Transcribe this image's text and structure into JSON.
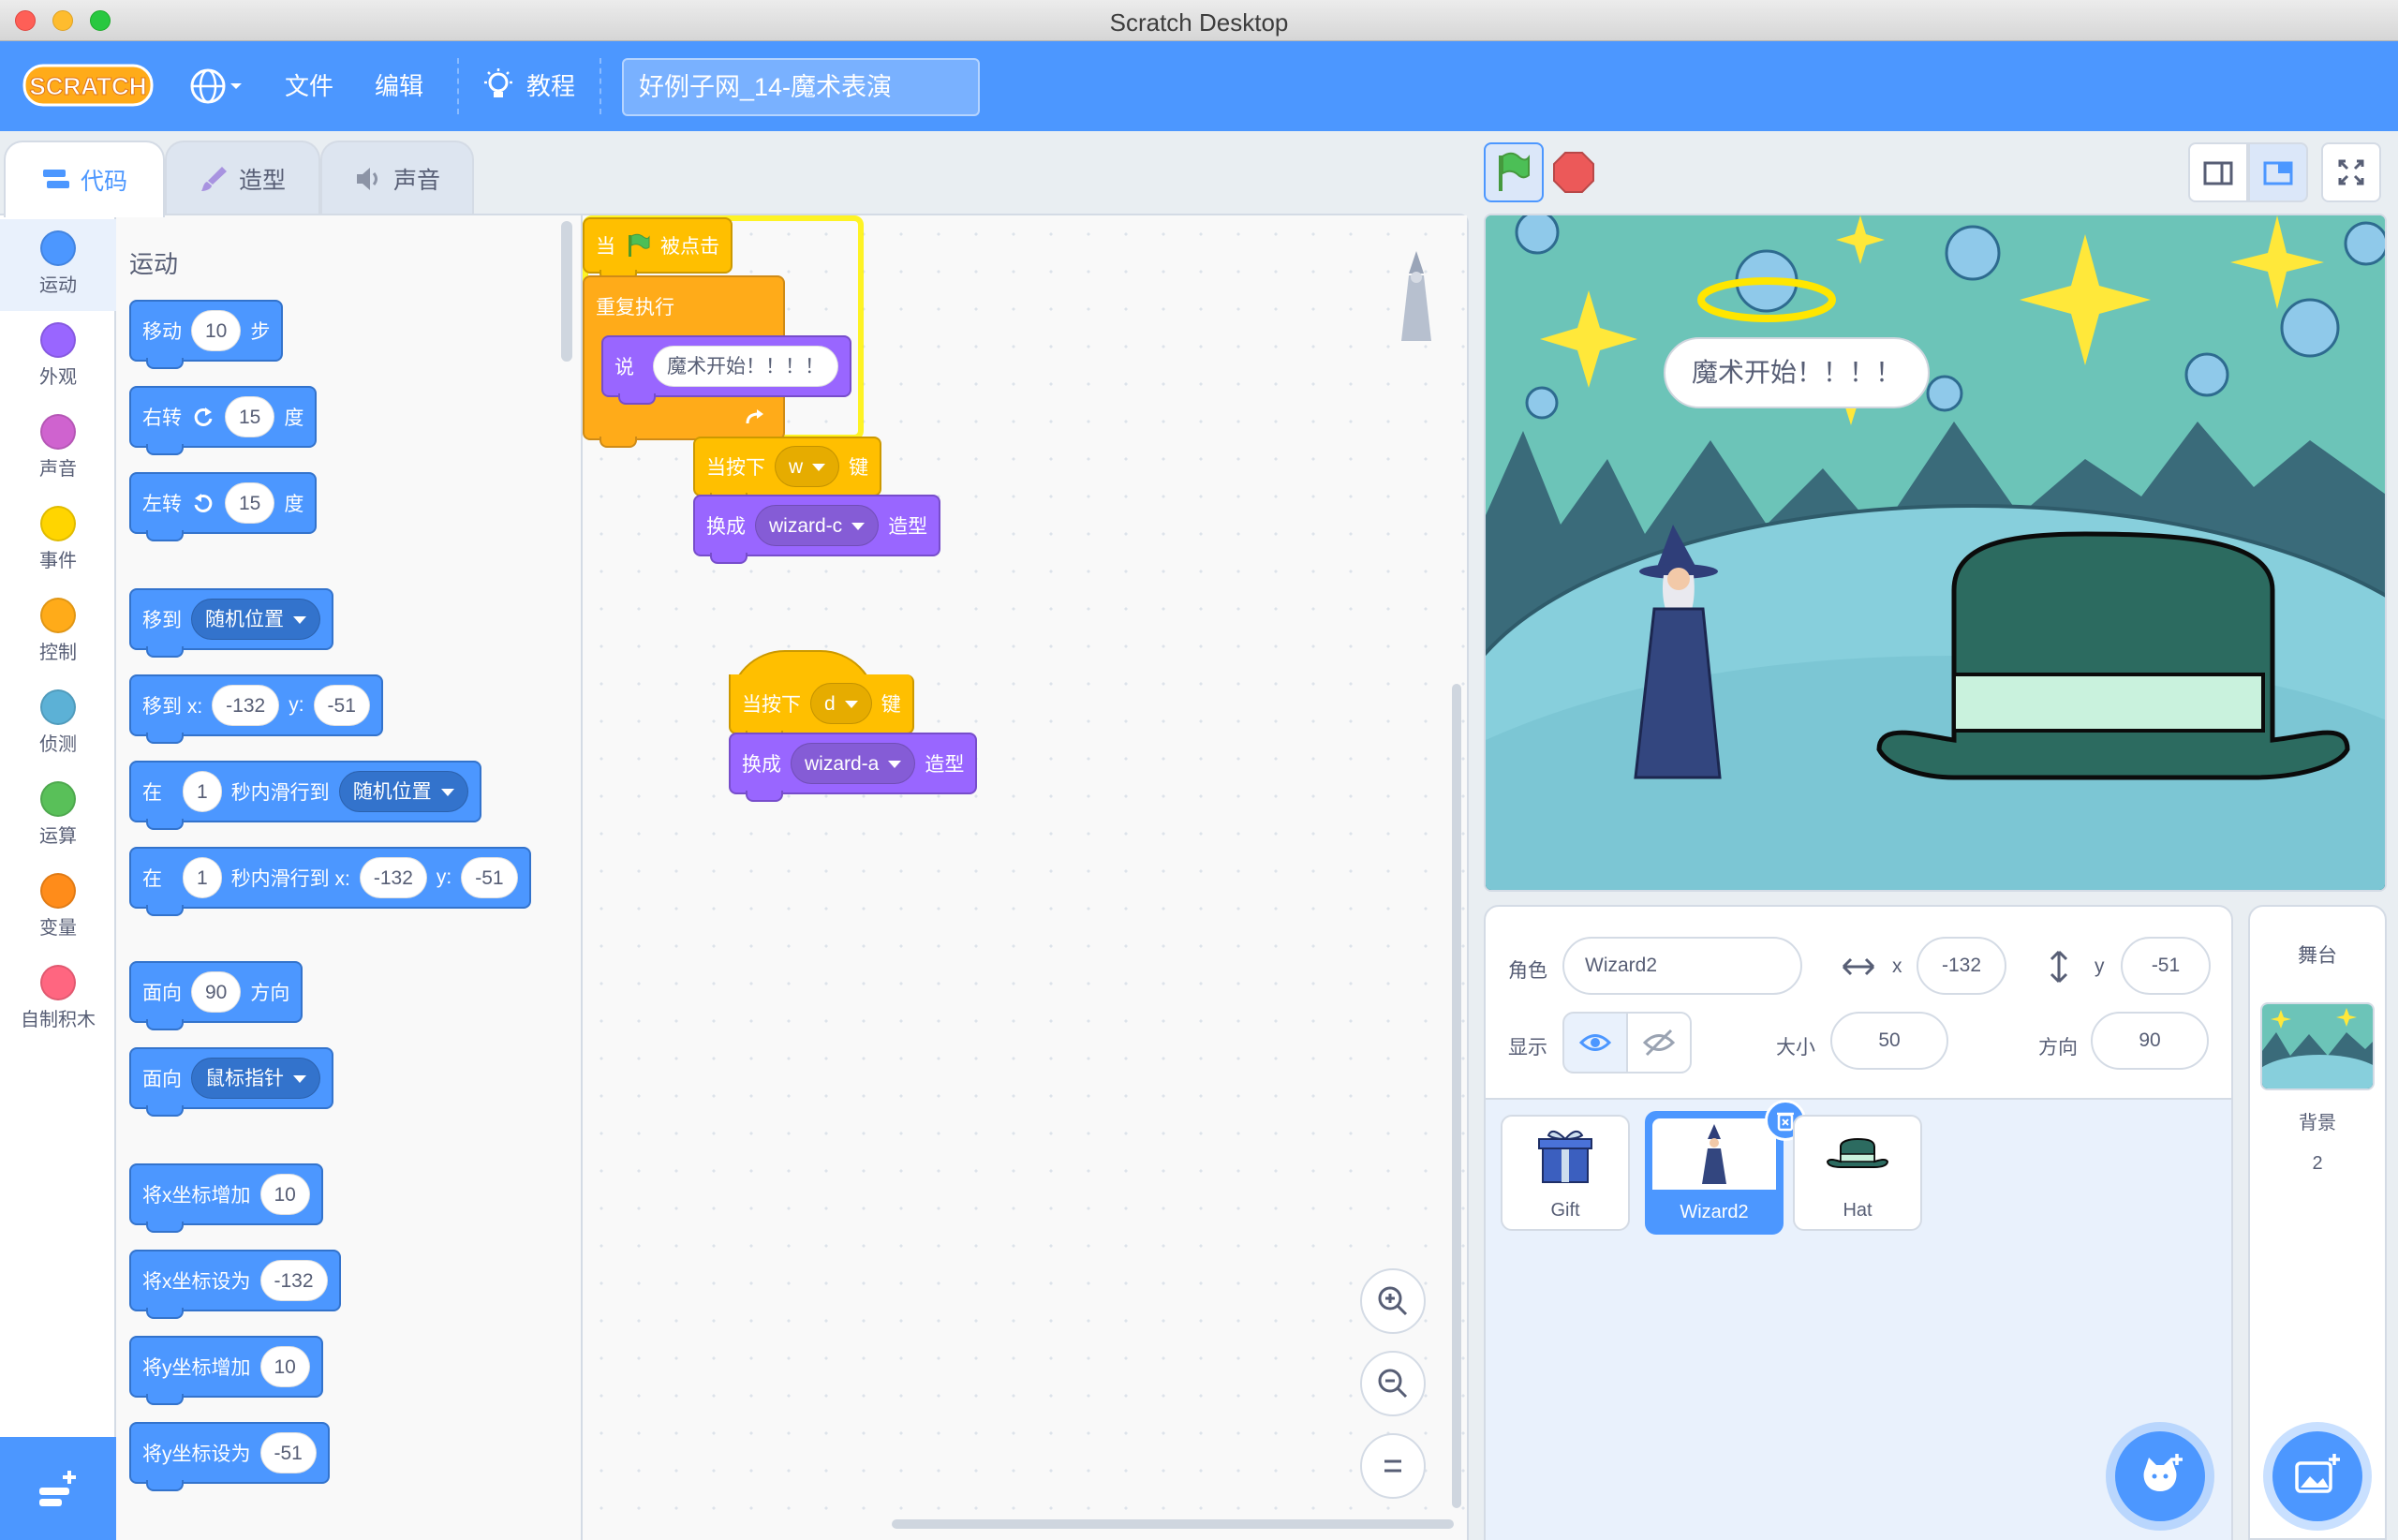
{
  "window": {
    "title": "Scratch Desktop"
  },
  "menubar": {
    "file": "文件",
    "edit": "编辑",
    "tutorials": "教程",
    "project_title": "好例子网_14-魔术表演"
  },
  "tabs": {
    "code": "代码",
    "costumes": "造型",
    "sounds": "声音"
  },
  "categories": [
    {
      "label": "运动",
      "color": "#4c97ff"
    },
    {
      "label": "外观",
      "color": "#9966ff"
    },
    {
      "label": "声音",
      "color": "#cf63cf"
    },
    {
      "label": "事件",
      "color": "#ffd500"
    },
    {
      "label": "控制",
      "color": "#ffab19"
    },
    {
      "label": "侦测",
      "color": "#5cb1d6"
    },
    {
      "label": "运算",
      "color": "#59c059"
    },
    {
      "label": "变量",
      "color": "#ff8c1a"
    },
    {
      "label": "自制积木",
      "color": "#ff6680"
    }
  ],
  "palette": {
    "section_title": "运动",
    "move": {
      "label": "移动",
      "value": "10",
      "unit": "步"
    },
    "turn_right": {
      "label": "右转",
      "value": "15",
      "unit": "度"
    },
    "turn_left": {
      "label": "左转",
      "value": "15",
      "unit": "度"
    },
    "goto": {
      "label": "移到",
      "option": "随机位置"
    },
    "goto_xy": {
      "label": "移到 x:",
      "x": "-132",
      "ylabel": "y:",
      "y": "-51"
    },
    "glide": {
      "label": "在",
      "secs": "1",
      "mid": "秒内滑行到",
      "option": "随机位置"
    },
    "glide_xy": {
      "label": "在",
      "secs": "1",
      "mid": "秒内滑行到 x:",
      "x": "-132",
      "ylabel": "y:",
      "y": "-51"
    },
    "point_dir": {
      "label": "面向",
      "value": "90",
      "unit": "方向"
    },
    "point_towards": {
      "label": "面向",
      "option": "鼠标指针"
    },
    "change_x": {
      "label": "将x坐标增加",
      "value": "10"
    },
    "set_x": {
      "label": "将x坐标设为",
      "value": "-132"
    },
    "change_y": {
      "label": "将y坐标增加",
      "value": "10"
    },
    "set_y": {
      "label": "将y坐标设为",
      "value": "-51"
    }
  },
  "scripts": {
    "flag_hat": {
      "pre": "当",
      "post": "被点击"
    },
    "forever": {
      "label": "重复执行"
    },
    "say": {
      "label": "说",
      "text": "魔术开始！！！！"
    },
    "key_w": {
      "pre": "当按下",
      "key": "w",
      "post": "键"
    },
    "switch_c": {
      "label": "换成",
      "costume": "wizard-c",
      "post": "造型"
    },
    "key_d": {
      "pre": "当按下",
      "key": "d",
      "post": "键"
    },
    "switch_a": {
      "label": "换成",
      "costume": "wizard-a",
      "post": "造型"
    }
  },
  "stage": {
    "speech": "魔术开始！！！！"
  },
  "sprite_info": {
    "sprite_label": "角色",
    "sprite_name": "Wizard2",
    "x_label": "x",
    "x": "-132",
    "y_label": "y",
    "y": "-51",
    "show_label": "显示",
    "size_label": "大小",
    "size": "50",
    "direction_label": "方向",
    "direction": "90"
  },
  "sprites": [
    {
      "name": "Gift"
    },
    {
      "name": "Wizard2"
    },
    {
      "name": "Hat"
    }
  ],
  "stage_panel": {
    "title": "舞台",
    "backdrop_label": "背景",
    "backdrop_count": "2"
  }
}
